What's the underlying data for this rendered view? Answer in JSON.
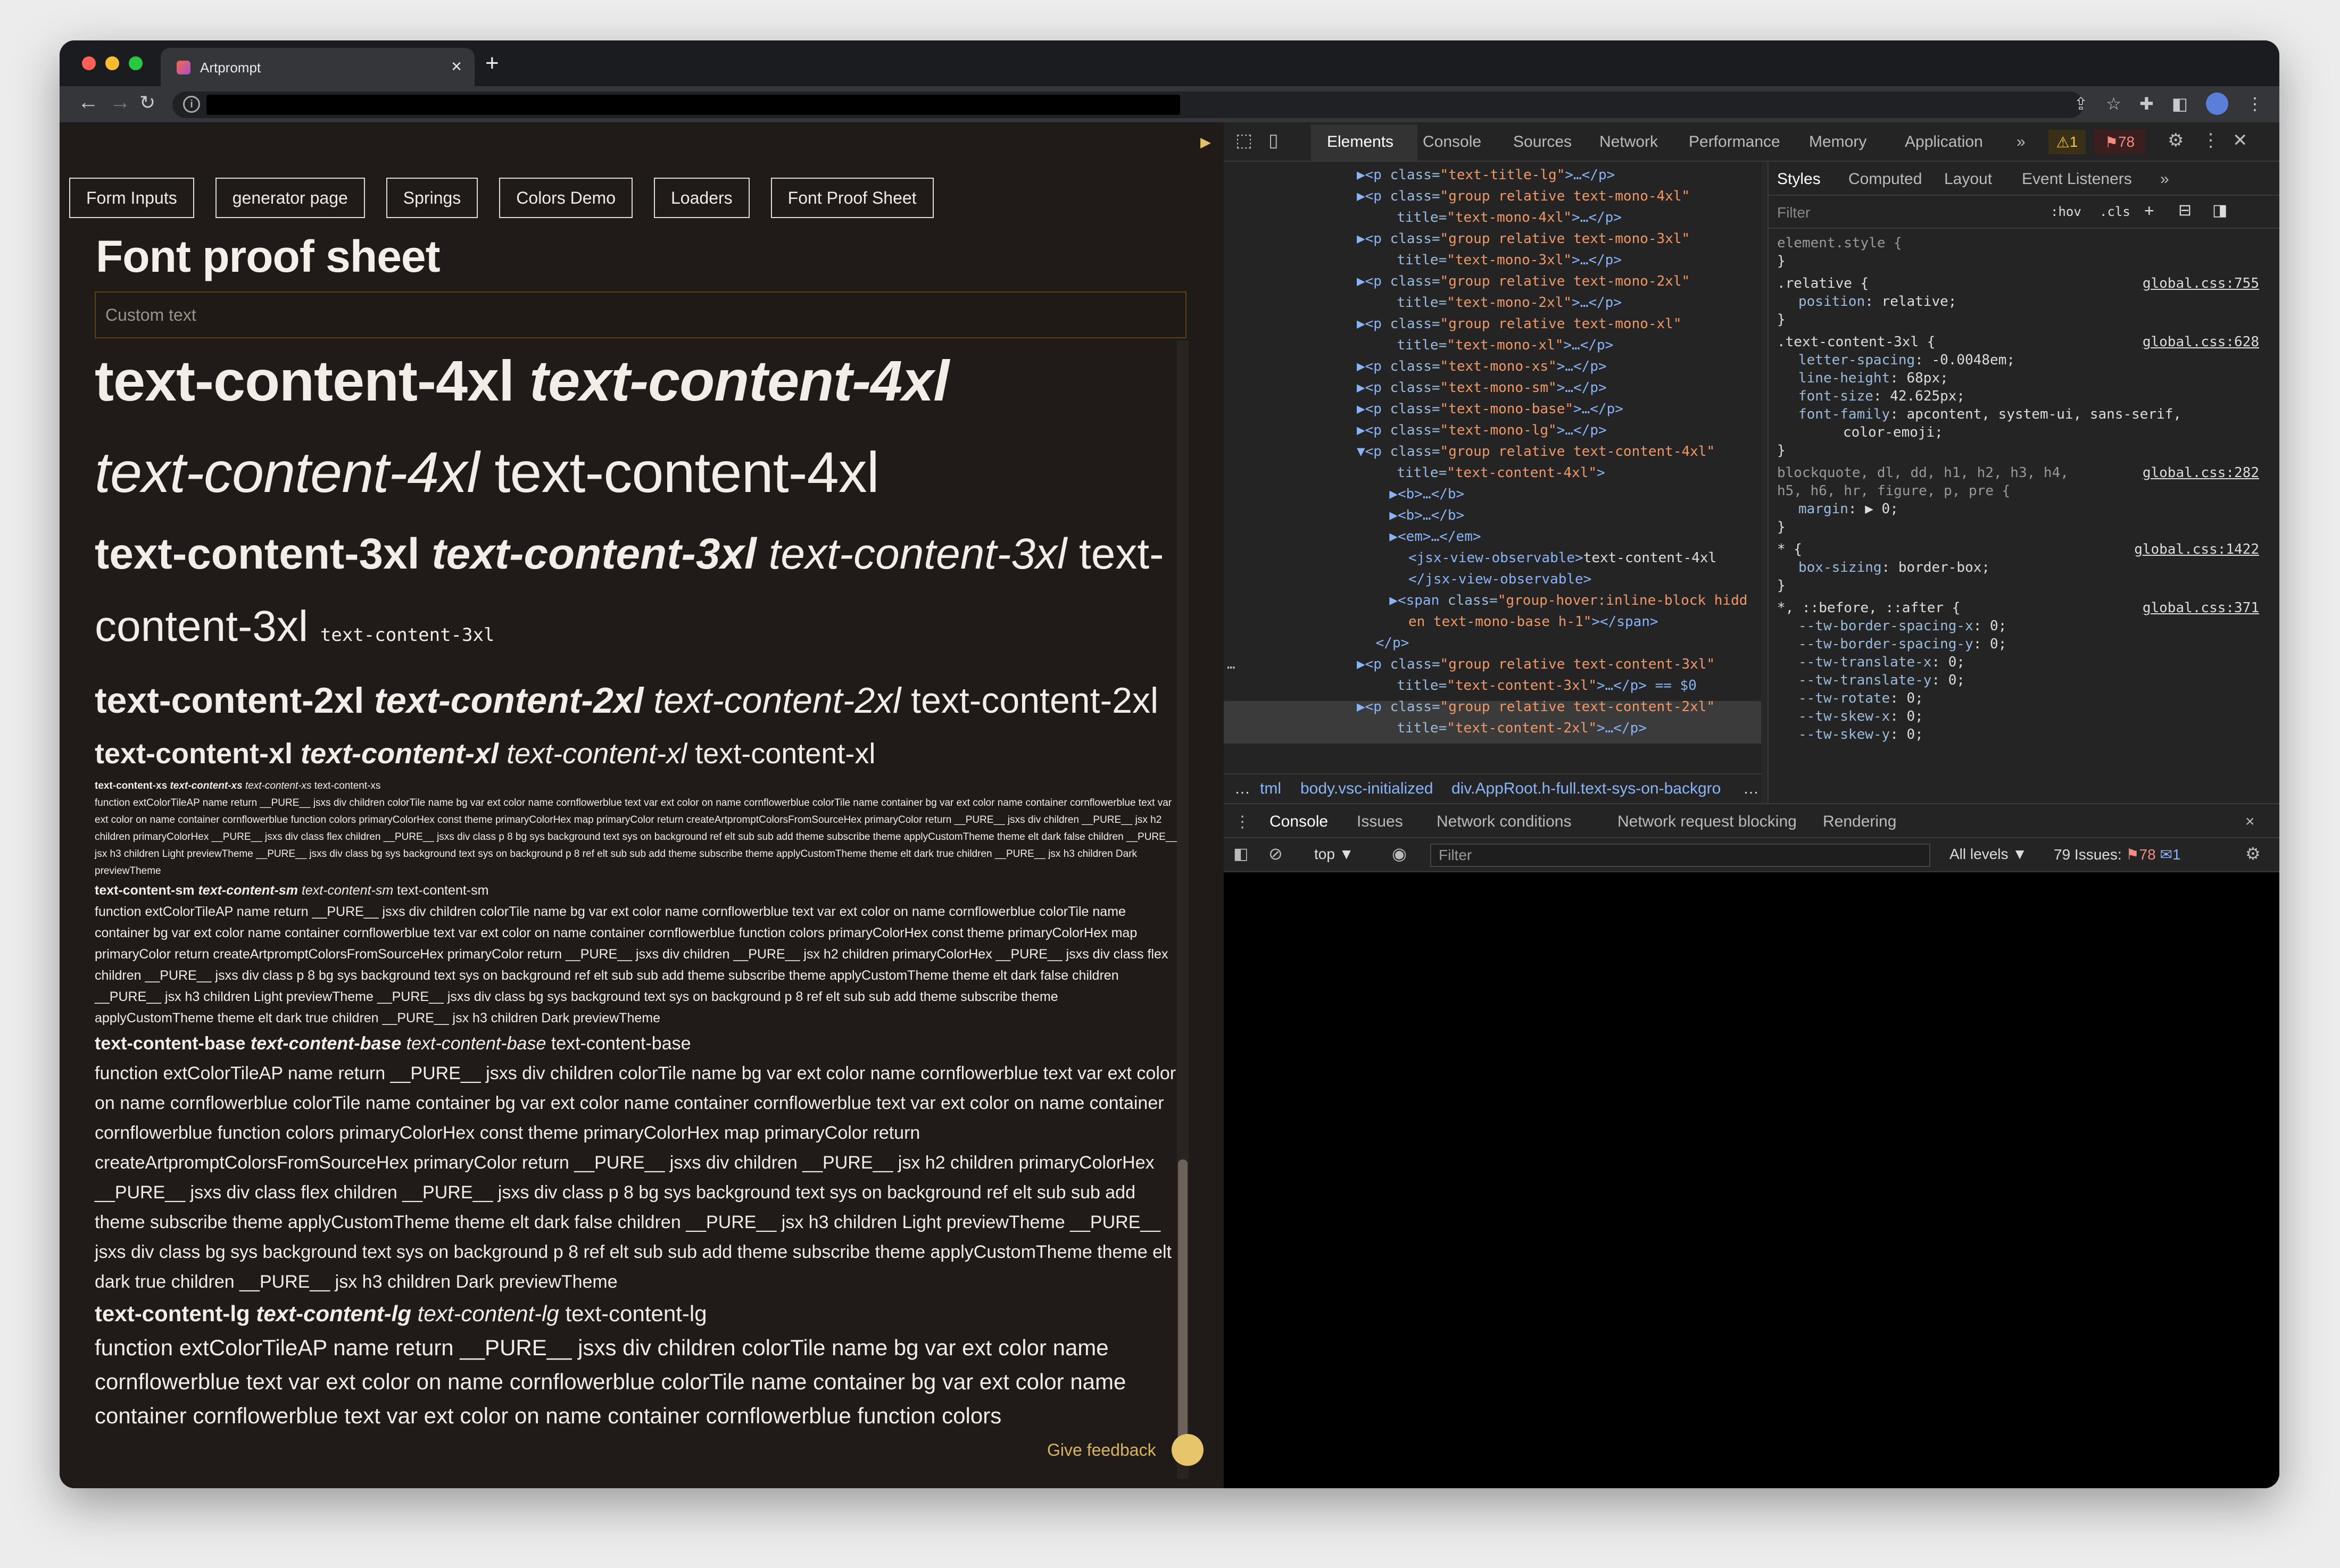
{
  "browser": {
    "tab_title": "Artprompt",
    "tab_close": "×",
    "new_tab": "+"
  },
  "page": {
    "nav_buttons": [
      "Form Inputs",
      "generator page",
      "Springs",
      "Colors Demo",
      "Loaders",
      "Font Proof Sheet"
    ],
    "title": "Font proof sheet",
    "custom_text_placeholder": "Custom text",
    "feedback_label": "Give feedback",
    "samples": {
      "c4_b": "text-content-4xl",
      "c4_bi": "text-content-4xl",
      "c4_i": "text-content-4xl",
      "c4_r": "text-content-4xl",
      "c3_b": "text-content-3xl",
      "c3_bi": "text-content-3xl",
      "c3_i": "text-content-3xl",
      "c3_r": "text-content-3xl",
      "c3_m": "text-content-3xl",
      "c2_b": "text-content-2xl",
      "c2_bi": "text-content-2xl",
      "c2_i": "text-content-2xl",
      "c2_r": "text-content-2xl",
      "c1_b": "text-content-xl",
      "c1_bi": "text-content-xl",
      "c1_i": "text-content-xl",
      "c1_r": "text-content-xl",
      "xs_b": "text-content-xs",
      "xs_bi": "text-content-xs",
      "xs_i": "text-content-xs",
      "xs_r": "text-content-xs",
      "sm_b": "text-content-sm",
      "sm_bi": "text-content-sm",
      "sm_i": "text-content-sm",
      "sm_r": "text-content-sm",
      "base_b": "text-content-base",
      "base_bi": "text-content-base",
      "base_i": "text-content-base",
      "base_r": "text-content-base",
      "lg_b": "text-content-lg",
      "lg_bi": "text-content-lg",
      "lg_i": "text-content-lg",
      "lg_r": "text-content-lg",
      "code_text": "function extColorTileAP name return __PURE__ jsxs div children colorTile name bg var ext color name cornflowerblue text var ext color on name cornflowerblue colorTile name container bg var ext color name container cornflowerblue text var ext color on name container cornflowerblue function colors primaryColorHex const theme primaryColorHex map primaryColor return createArtpromptColorsFromSourceHex primaryColor return __PURE__ jsxs div children __PURE__ jsx h2 children primaryColorHex __PURE__ jsxs div class flex children __PURE__ jsxs div class p 8 bg sys background text sys on background ref elt sub sub add theme subscribe theme applyCustomTheme theme elt dark false children __PURE__ jsx h3 children Light previewTheme __PURE__ jsxs div class bg sys background text sys on background p 8 ref elt sub sub add theme subscribe theme applyCustomTheme theme elt dark true children __PURE__ jsx h3 children Dark previewTheme",
      "code_text_lg": "function extColorTileAP name return __PURE__ jsxs div children colorTile name bg var ext color name cornflowerblue text var ext color on name cornflowerblue colorTile name container bg var ext color name container cornflowerblue text var ext color on name container cornflowerblue function colors"
    }
  },
  "devtools": {
    "tabs": [
      "Elements",
      "Console",
      "Sources",
      "Network",
      "Performance",
      "Memory",
      "Application"
    ],
    "more_tabs": "»",
    "warnings": "1",
    "errors": "78",
    "dom_lines": [
      {
        "tag": "▶<p ",
        "attr": "class=",
        "val": "\"text-title-lg\"",
        "tail": ">…</p>"
      },
      {
        "tag": "▶<p ",
        "attr": "class=",
        "val": "\"group relative text-mono-4xl\"",
        "tail": ""
      },
      {
        "tag": "  ",
        "attr": "title=",
        "val": "\"text-mono-4xl\"",
        "tail": ">…</p>"
      },
      {
        "tag": "▶<p ",
        "attr": "class=",
        "val": "\"group relative text-mono-3xl\"",
        "tail": ""
      },
      {
        "tag": "  ",
        "attr": "title=",
        "val": "\"text-mono-3xl\"",
        "tail": ">…</p>"
      },
      {
        "tag": "▶<p ",
        "attr": "class=",
        "val": "\"group relative text-mono-2xl\"",
        "tail": ""
      },
      {
        "tag": "  ",
        "attr": "title=",
        "val": "\"text-mono-2xl\"",
        "tail": ">…</p>"
      },
      {
        "tag": "▶<p ",
        "attr": "class=",
        "val": "\"group relative text-mono-xl\"",
        "tail": ""
      },
      {
        "tag": "  ",
        "attr": "title=",
        "val": "\"text-mono-xl\"",
        "tail": ">…</p>"
      },
      {
        "tag": "▶<p ",
        "attr": "class=",
        "val": "\"text-mono-xs\"",
        "tail": ">…</p>"
      },
      {
        "tag": "▶<p ",
        "attr": "class=",
        "val": "\"text-mono-sm\"",
        "tail": ">…</p>"
      },
      {
        "tag": "▶<p ",
        "attr": "class=",
        "val": "\"text-mono-base\"",
        "tail": ">…</p>"
      },
      {
        "tag": "▶<p ",
        "attr": "class=",
        "val": "\"text-mono-lg\"",
        "tail": ">…</p>"
      },
      {
        "tag": "▼<p ",
        "attr": "class=",
        "val": "\"group relative text-content-4xl\"",
        "tail": ""
      },
      {
        "tag": "  ",
        "attr": "title=",
        "val": "\"text-content-4xl\"",
        "tail": ">"
      },
      {
        "tag": "  ▶<b>",
        "attr": "",
        "val": "",
        "tail": "…</b>"
      },
      {
        "tag": "  ▶<b>",
        "attr": "",
        "val": "",
        "tail": "…</b>"
      },
      {
        "tag": "  ▶<em>",
        "attr": "",
        "val": "",
        "tail": "…</em>"
      },
      {
        "tag": "   <jsx-view-observable>",
        "attr": "",
        "val": "",
        "tail": "text-content-4xl"
      },
      {
        "tag": "   </jsx-view-observable>",
        "attr": "",
        "val": "",
        "tail": ""
      },
      {
        "tag": "  ▶<span ",
        "attr": "class=",
        "val": "\"group-hover:inline-block hidd",
        "tail": ""
      },
      {
        "tag": "   ",
        "attr": "",
        "val": "en text-mono-base h-1\"",
        "tail": "></span>"
      },
      {
        "tag": " </p>",
        "attr": "",
        "val": "",
        "tail": ""
      },
      {
        "tag": "▶<p ",
        "attr": "class=",
        "val": "\"group relative text-content-3xl\"",
        "tail": ""
      },
      {
        "tag": "  ",
        "attr": "title=",
        "val": "\"text-content-3xl\"",
        "tail": ">…</p> == $0"
      },
      {
        "tag": "▶<p ",
        "attr": "class=",
        "val": "\"group relative text-content-2xl\"",
        "tail": ""
      },
      {
        "tag": "  ",
        "attr": "title=",
        "val": "\"text-content-2xl\"",
        "tail": ">…</p>"
      }
    ],
    "breadcrumbs": [
      "…",
      "tml",
      "body.vsc-initialized",
      "div.AppRoot.h-full.text-sys-on-backgro",
      "…"
    ],
    "styles_tabs": [
      "Styles",
      "Computed",
      "Layout",
      "Event Listeners",
      "»"
    ],
    "styles_filter": "Filter",
    "hov": ":hov",
    "cls": ".cls",
    "rules": {
      "element_style": "element.style {",
      "close": "}",
      "relative_sel": ".relative {",
      "relative_src": "global.css:755",
      "relative_p": "position",
      "relative_v": "relative;",
      "tc3_sel": ".text-content-3xl {",
      "tc3_src": "global.css:628",
      "p1": "letter-spacing",
      "v1": "-0.0048em;",
      "p2": "line-height",
      "v2": "68px;",
      "p3": "font-size",
      "v3": "42.625px;",
      "p4": "font-family",
      "v4": "apcontent, system-ui, sans-serif,",
      "v4b": "color-emoji;",
      "bq_sel": "blockquote, dl, dd, h1, h2, h3, h4,",
      "bq_sel2": "h5, h6, hr, figure, p, pre {",
      "bq_src": "global.css:282",
      "bq_p": "margin",
      "bq_v": "▶ 0;",
      "star_sel": "* {",
      "star_src": "global.css:1422",
      "star_p": "box-sizing",
      "star_v": "border-box;",
      "before_sel": "*, ::before, ::after {",
      "before_src": "global.css:371",
      "tw": [
        "--tw-border-spacing-x",
        "--tw-border-spacing-y",
        "--tw-translate-x",
        "--tw-translate-y",
        "--tw-rotate",
        "--tw-skew-x",
        "--tw-skew-y"
      ],
      "tw_v": "0;"
    },
    "drawer_tabs": [
      "Console",
      "Issues",
      "Network conditions",
      "Network request blocking",
      "Rendering"
    ],
    "drawer_close": "×",
    "console_context": "top ▼",
    "console_filter": "Filter",
    "levels": "All levels ▼",
    "issues": "79 Issues:",
    "issues_err": "78",
    "issues_info": "1"
  },
  "colors": {
    "page_bg": "#201b18",
    "accent_gold": "#e5c06b",
    "devtools_blue": "#8ab4f8"
  }
}
